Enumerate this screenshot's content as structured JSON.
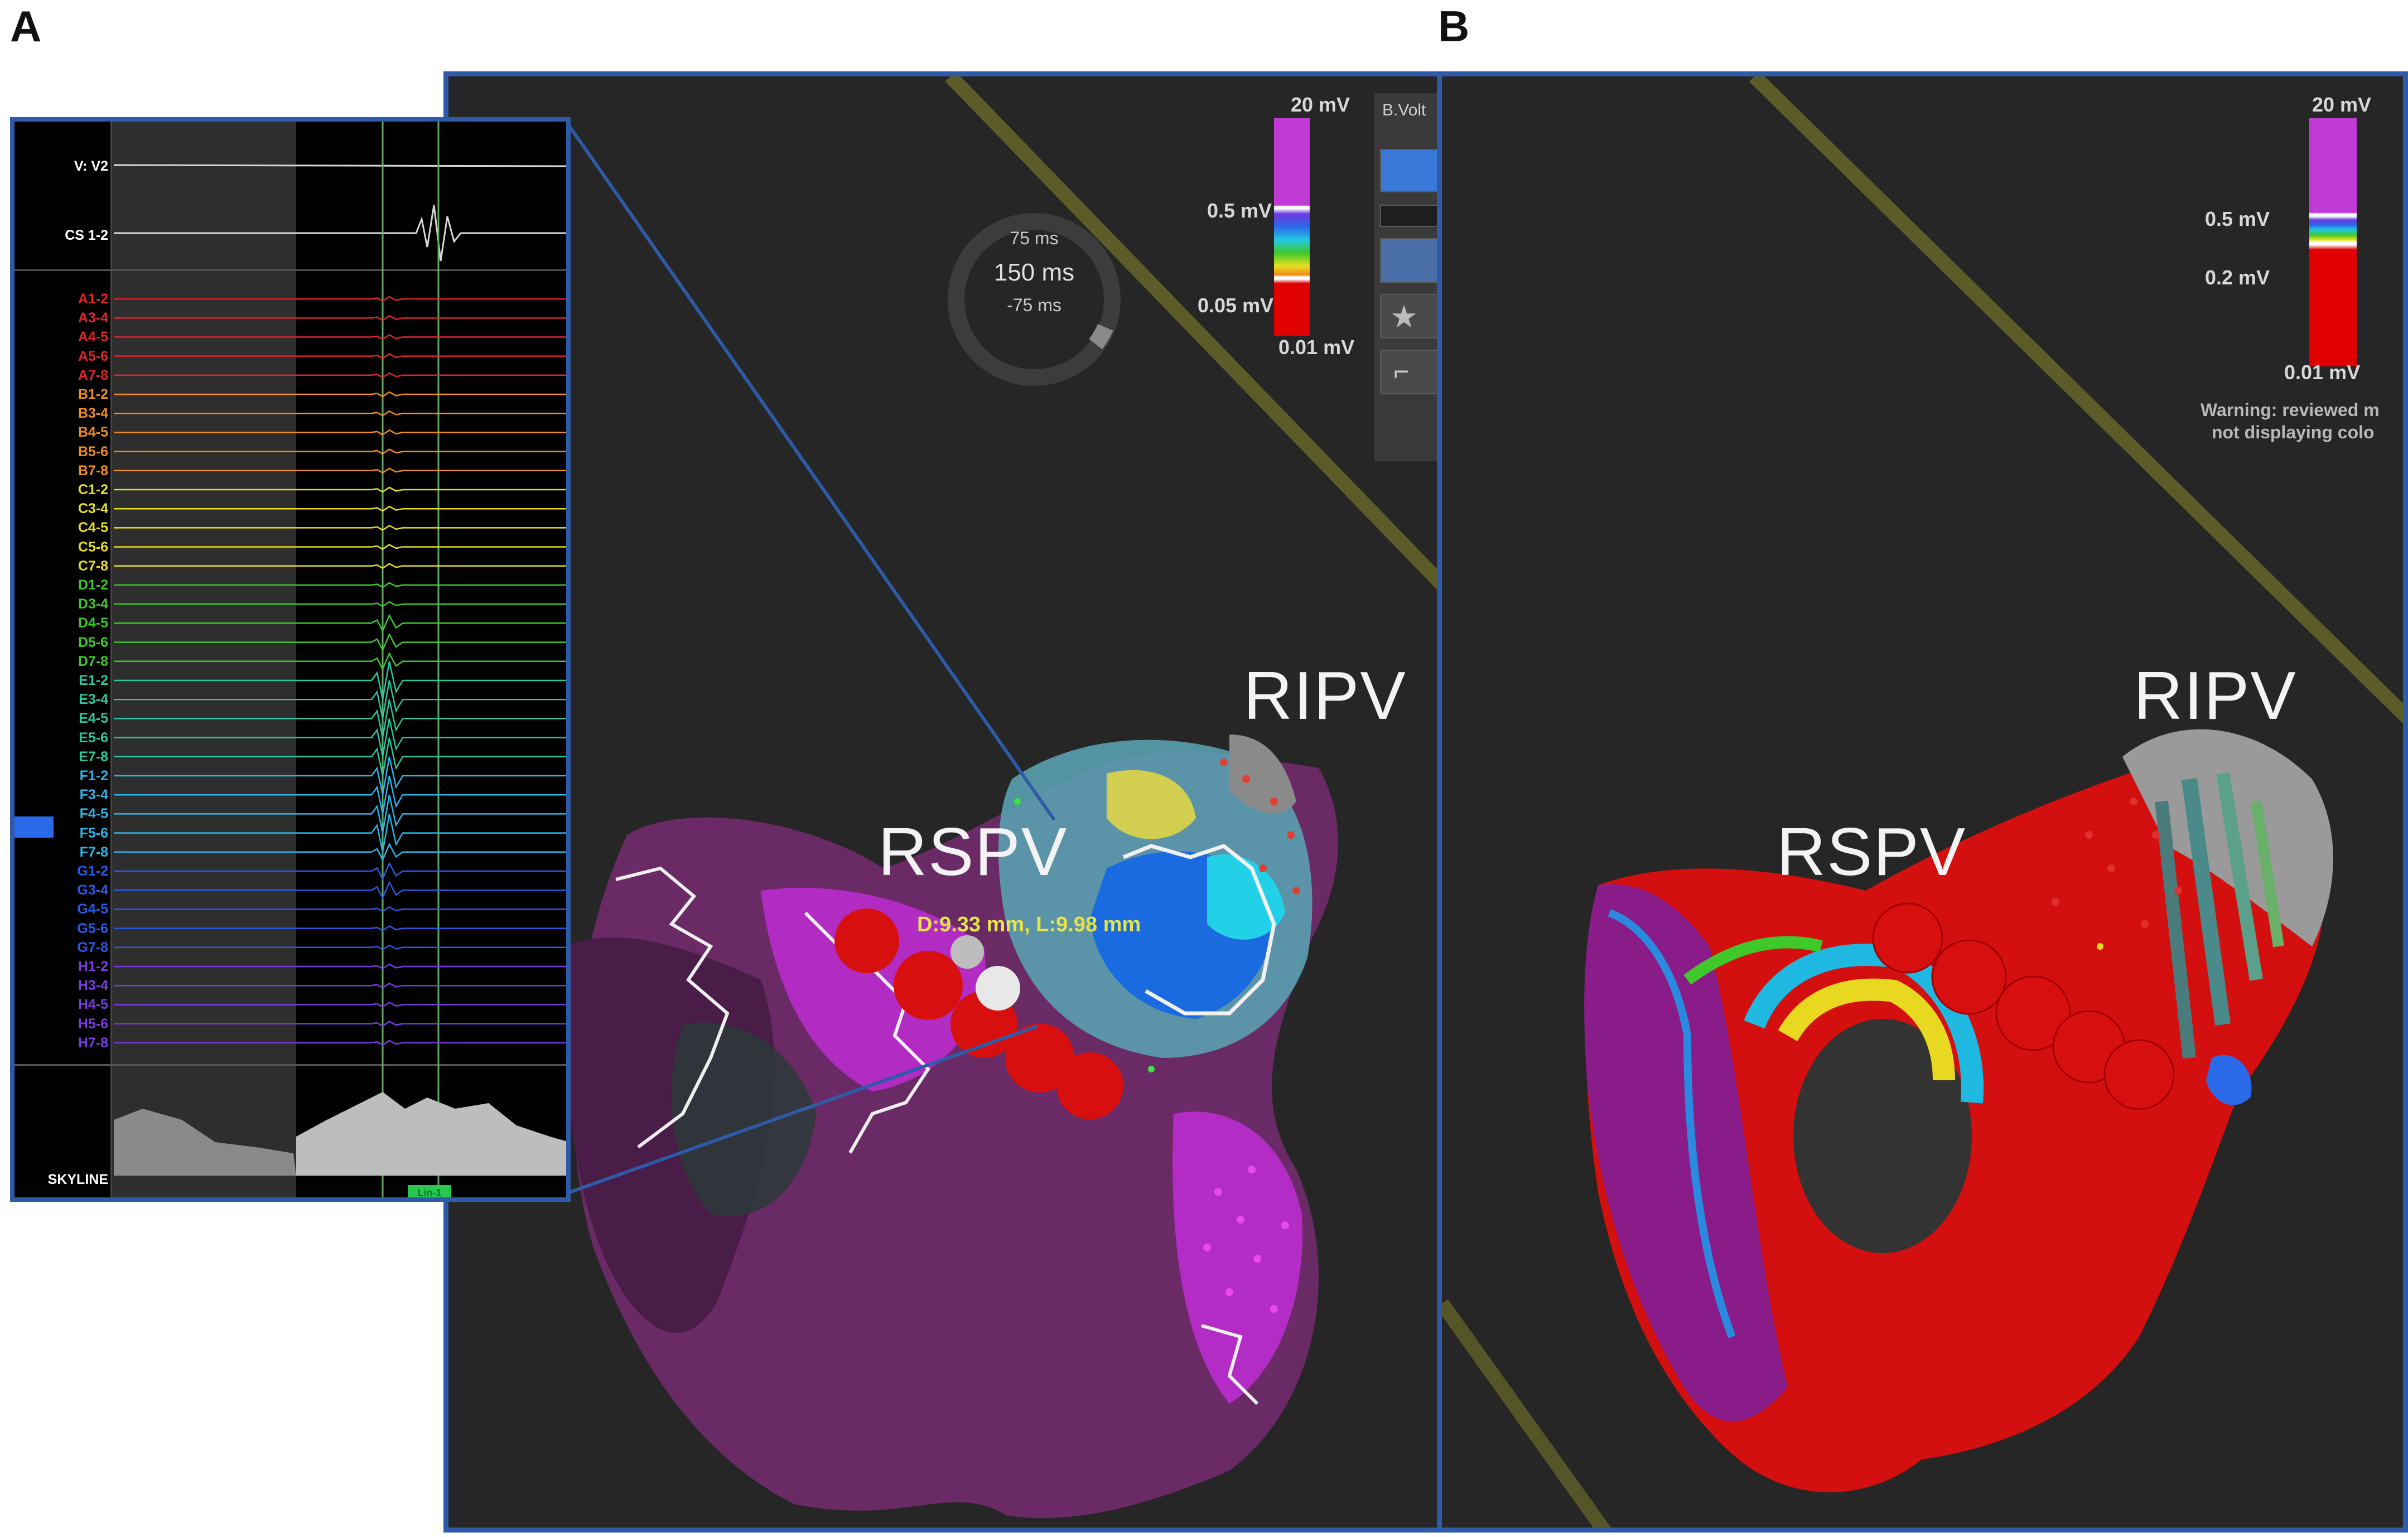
{
  "panels": {
    "a": {
      "letter": "A"
    },
    "b": {
      "letter": "B"
    }
  },
  "panel_a": {
    "view_label": "B.Volt",
    "ring": {
      "top": "75 ms",
      "center": "150 ms",
      "bottom": "-75 ms"
    },
    "scale": {
      "max": "20 mV",
      "upper": "0.5 mV",
      "lower": "0.05 mV",
      "min": "0.01 mV"
    },
    "labels": {
      "rspv": "RSPV",
      "ripv": "RIPV"
    },
    "measurement": "D:9.33 mm, L:9.98 mm",
    "egm": {
      "surface_lead": "V: V2",
      "cs_lead": "CS 1-2",
      "skyline": "SKYLINE",
      "selected_channel": "F5-6",
      "marker": "Lin-1",
      "channels": [
        {
          "name": "A1-2",
          "color": "#e0242a"
        },
        {
          "name": "A3-4",
          "color": "#e0242a"
        },
        {
          "name": "A4-5",
          "color": "#e0242a"
        },
        {
          "name": "A5-6",
          "color": "#e0242a"
        },
        {
          "name": "A7-8",
          "color": "#e0242a"
        },
        {
          "name": "B1-2",
          "color": "#f08c1c"
        },
        {
          "name": "B3-4",
          "color": "#f08c1c"
        },
        {
          "name": "B4-5",
          "color": "#f08c1c"
        },
        {
          "name": "B5-6",
          "color": "#f08c1c"
        },
        {
          "name": "B7-8",
          "color": "#f08c1c"
        },
        {
          "name": "C1-2",
          "color": "#e8e020"
        },
        {
          "name": "C3-4",
          "color": "#e8e020"
        },
        {
          "name": "C4-5",
          "color": "#e8e020"
        },
        {
          "name": "C5-6",
          "color": "#e8e020"
        },
        {
          "name": "C7-8",
          "color": "#e8e020"
        },
        {
          "name": "D1-2",
          "color": "#3ec82a"
        },
        {
          "name": "D3-4",
          "color": "#3ec82a"
        },
        {
          "name": "D4-5",
          "color": "#3ec82a"
        },
        {
          "name": "D5-6",
          "color": "#3ec82a"
        },
        {
          "name": "D7-8",
          "color": "#3ec82a"
        },
        {
          "name": "E1-2",
          "color": "#28c8a0"
        },
        {
          "name": "E3-4",
          "color": "#28c8a0"
        },
        {
          "name": "E4-5",
          "color": "#28c8a0"
        },
        {
          "name": "E5-6",
          "color": "#28c8a0"
        },
        {
          "name": "E7-8",
          "color": "#28c8a0"
        },
        {
          "name": "F1-2",
          "color": "#2ab4e8"
        },
        {
          "name": "F3-4",
          "color": "#2ab4e8"
        },
        {
          "name": "F4-5",
          "color": "#2ab4e8"
        },
        {
          "name": "F5-6",
          "color": "#2ab4e8"
        },
        {
          "name": "F7-8",
          "color": "#2ab4e8"
        },
        {
          "name": "G1-2",
          "color": "#2a5ae8"
        },
        {
          "name": "G3-4",
          "color": "#2a5ae8"
        },
        {
          "name": "G4-5",
          "color": "#2a5ae8"
        },
        {
          "name": "G5-6",
          "color": "#2a5ae8"
        },
        {
          "name": "G7-8",
          "color": "#2a5ae8"
        },
        {
          "name": "H1-2",
          "color": "#7a3ae0"
        },
        {
          "name": "H3-4",
          "color": "#7a3ae0"
        },
        {
          "name": "H4-5",
          "color": "#7a3ae0"
        },
        {
          "name": "H5-6",
          "color": "#7a3ae0"
        },
        {
          "name": "H7-8",
          "color": "#7a3ae0"
        }
      ]
    }
  },
  "panel_b": {
    "scale": {
      "max": "20 mV",
      "upper": "0.5 mV",
      "lower": "0.2 mV",
      "min": "0.01 mV"
    },
    "labels": {
      "rspv": "RSPV",
      "ripv": "RIPV"
    },
    "warning_line1": "Warning: reviewed m",
    "warning_line2": "not displaying colo"
  },
  "colors": {
    "frame": "#2f5aa8",
    "background": "#262626",
    "scar": "#e00000",
    "healthy": "#c02ad0"
  }
}
